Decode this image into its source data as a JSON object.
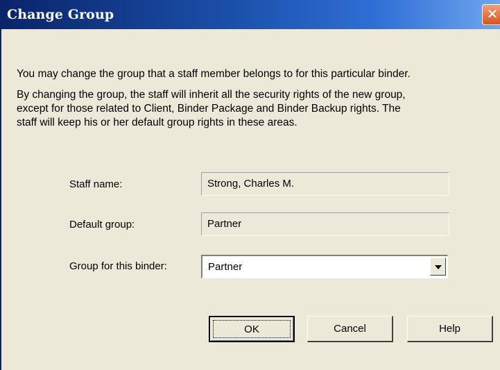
{
  "window": {
    "title": "Change Group",
    "close_glyph": "✕"
  },
  "body": {
    "intro": "You may change the group that a staff member belongs to for this particular binder.",
    "explanation_lines": [
      "By changing the group, the staff will inherit all the security rights of the new group,",
      "except for those related to Client, Binder Package and Binder Backup rights.  The",
      "staff will keep his or her default group rights in these areas."
    ]
  },
  "form": {
    "staff_name_label": "Staff name:",
    "staff_name_value": "Strong, Charles M.",
    "default_group_label": "Default group:",
    "default_group_value": "Partner",
    "binder_group_label": "Group for this binder:",
    "binder_group_value": "Partner"
  },
  "buttons": {
    "ok": "OK",
    "cancel": "Cancel",
    "help": "Help"
  },
  "colors": {
    "titlebar_start": "#0a246a",
    "titlebar_end": "#6fa6ec",
    "dialog_bg": "#ece9d8",
    "close_button": "#d9541e"
  },
  "icons": {
    "close": "close-icon",
    "dropdown": "chevron-down-icon"
  }
}
